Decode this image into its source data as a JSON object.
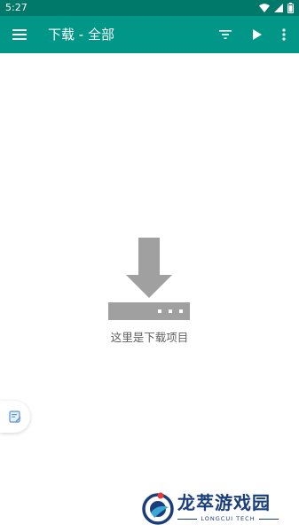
{
  "status_bar": {
    "time": "5:27",
    "icons": [
      "wifi-icon",
      "signal-icon",
      "battery-icon"
    ]
  },
  "app_bar": {
    "title": "下载 - 全部",
    "color": "#009688",
    "status_color": "#00796b",
    "actions": [
      "menu-icon",
      "filter-icon",
      "play-icon",
      "more-vert-icon"
    ]
  },
  "empty_state": {
    "icon": "download-to-device-icon",
    "label": "这里是下载项目"
  },
  "side_tab": {
    "icon": "edit-note-icon"
  },
  "watermark": {
    "name": "龙萃游戏园",
    "subtitle": "LONGCUI TECH"
  }
}
